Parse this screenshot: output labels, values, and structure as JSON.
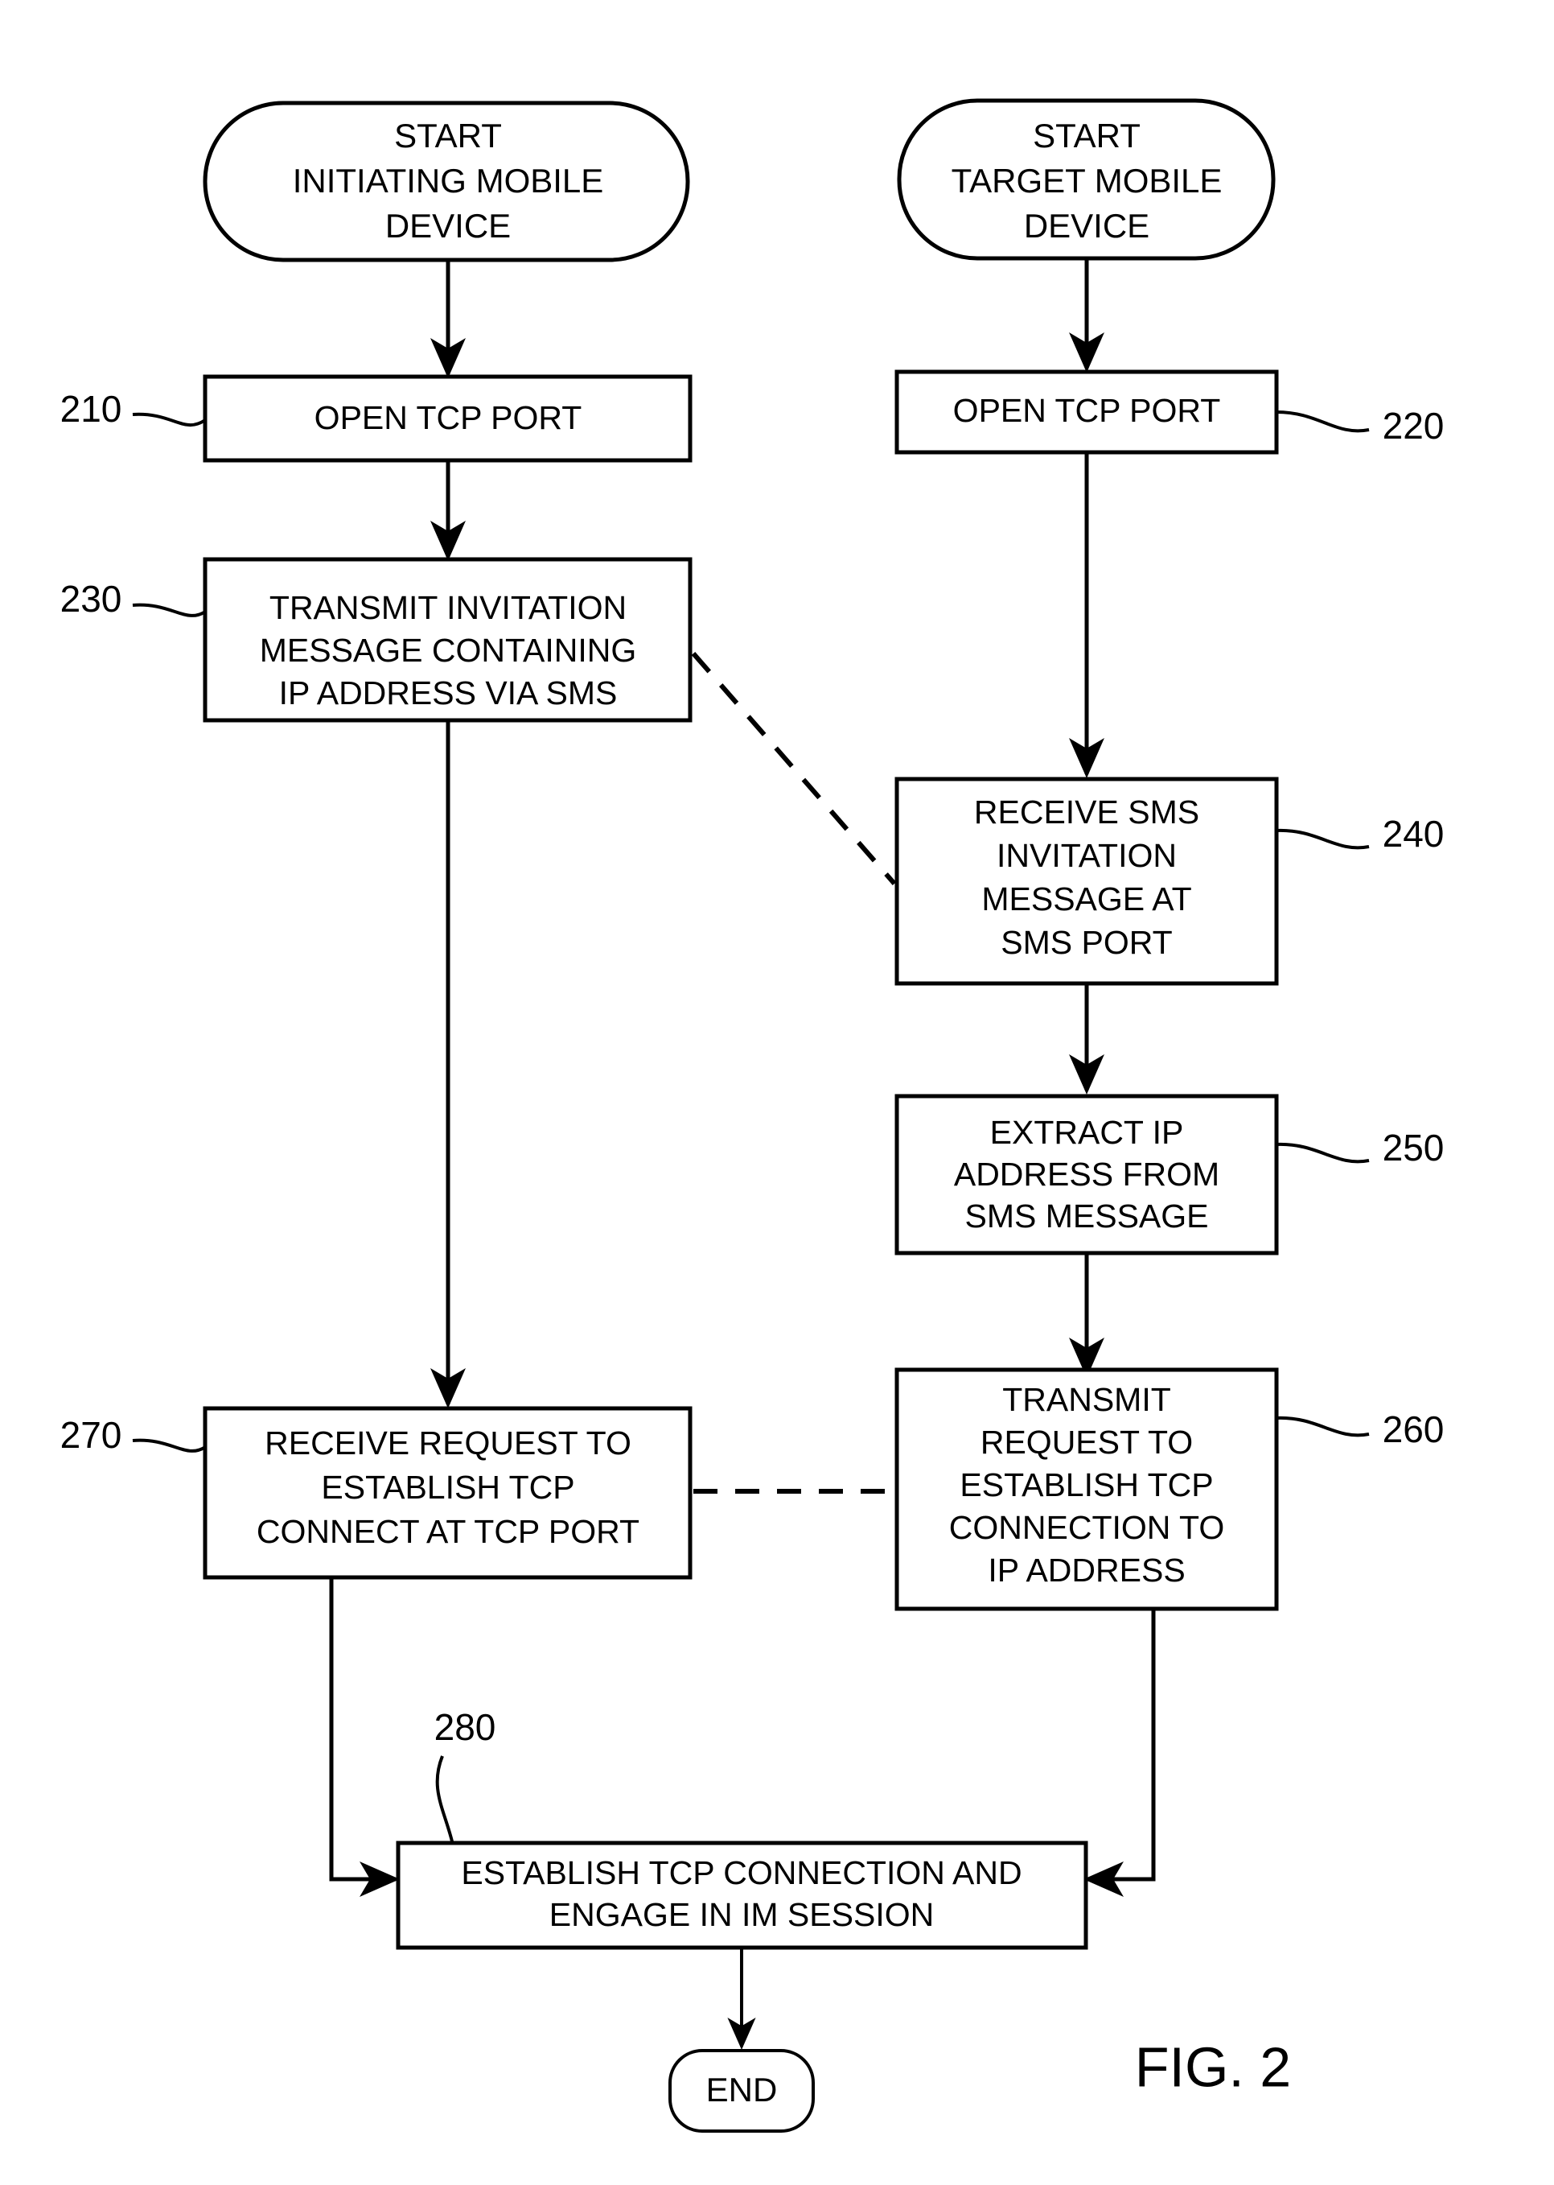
{
  "figure": {
    "label": "FIG. 2",
    "title": ""
  },
  "nodes": {
    "start_initiating": {
      "ref": "",
      "lines": [
        "START",
        "INITIATING MOBILE",
        "DEVICE"
      ],
      "shape": "terminator"
    },
    "start_target": {
      "ref": "",
      "lines": [
        "START",
        "TARGET MOBILE",
        "DEVICE"
      ],
      "shape": "terminator"
    },
    "open_tcp_port_left": {
      "ref": "210",
      "lines": [
        "OPEN TCP PORT"
      ],
      "shape": "process"
    },
    "open_tcp_port_right": {
      "ref": "220",
      "lines": [
        "OPEN TCP PORT"
      ],
      "shape": "process"
    },
    "transmit_invitation": {
      "ref": "230",
      "lines": [
        "TRANSMIT INVITATION",
        "MESSAGE CONTAINING",
        "IP ADDRESS VIA SMS"
      ],
      "shape": "process"
    },
    "receive_sms_invitation": {
      "ref": "240",
      "lines": [
        "RECEIVE SMS",
        "INVITATION",
        "MESSAGE AT",
        "SMS PORT"
      ],
      "shape": "process"
    },
    "extract_ip_address": {
      "ref": "250",
      "lines": [
        "EXTRACT IP",
        "ADDRESS FROM",
        "SMS MESSAGE"
      ],
      "shape": "process"
    },
    "transmit_request": {
      "ref": "260",
      "lines": [
        "TRANSMIT",
        "REQUEST TO",
        "ESTABLISH TCP",
        "CONNECTION TO",
        "IP ADDRESS"
      ],
      "shape": "process"
    },
    "receive_request": {
      "ref": "270",
      "lines": [
        "RECEIVE REQUEST TO",
        "ESTABLISH TCP",
        "CONNECT AT TCP PORT"
      ],
      "shape": "process"
    },
    "establish_connection": {
      "ref": "280",
      "lines": [
        "ESTABLISH TCP CONNECTION AND",
        "ENGAGE IN IM SESSION"
      ],
      "shape": "process"
    },
    "end": {
      "ref": "",
      "lines": [
        "END"
      ],
      "shape": "terminator"
    }
  },
  "colors": {
    "stroke": "#000000",
    "fill": "#ffffff",
    "text": "#000000"
  }
}
